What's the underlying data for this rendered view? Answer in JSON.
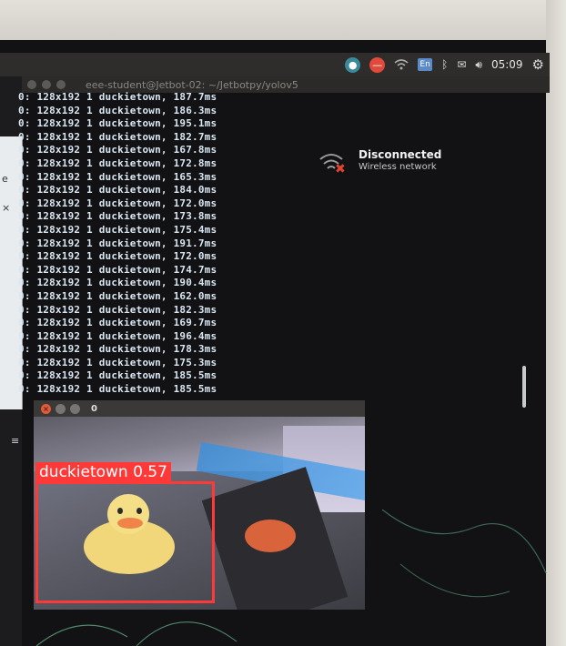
{
  "top_panel": {
    "keyboard_layout": "En",
    "clock": "05:09",
    "icons": [
      "cuda-icon",
      "do-not-enter-icon",
      "wifi-icon",
      "keyboard-icon",
      "bluetooth-icon",
      "mail-icon",
      "volume-icon",
      "gear-icon"
    ]
  },
  "terminal": {
    "title": "eee-student@Jetbot-02: ~/Jetbotpy/yolov5",
    "lines": [
      "0: 128x192 1 duckietown, 187.7ms",
      "0: 128x192 1 duckietown, 186.3ms",
      "0: 128x192 1 duckietown, 195.1ms",
      "0: 128x192 1 duckietown, 182.7ms",
      "0: 128x192 1 duckietown, 167.8ms",
      "0: 128x192 1 duckietown, 172.8ms",
      "0: 128x192 1 duckietown, 165.3ms",
      "0: 128x192 1 duckietown, 184.0ms",
      "0: 128x192 1 duckietown, 172.0ms",
      "0: 128x192 1 duckietown, 173.8ms",
      "0: 128x192 1 duckietown, 175.4ms",
      "0: 128x192 1 duckietown, 191.7ms",
      "0: 128x192 1 duckietown, 172.0ms",
      "0: 128x192 1 duckietown, 174.7ms",
      "0: 128x192 1 duckietown, 190.4ms",
      "0: 128x192 1 duckietown, 162.0ms",
      "0: 128x192 1 duckietown, 182.3ms",
      "0: 128x192 1 duckietown, 169.7ms",
      "0: 128x192 1 duckietown, 196.4ms",
      "0: 128x192 1 duckietown, 178.3ms",
      "0: 128x192 1 duckietown, 175.3ms",
      "0: 128x192 1 duckietown, 185.5ms",
      "0: 128x192 1 duckietown, 185.5ms"
    ]
  },
  "notification": {
    "title": "Disconnected",
    "body": "Wireless network",
    "icon": "wifi-disconnected-icon"
  },
  "video_window": {
    "title": "0",
    "detection_label": "duckietown 0.57",
    "box_color": "#ff3838"
  },
  "left_dock": {
    "partial_text_1": "e",
    "partial_text_2": "×"
  }
}
